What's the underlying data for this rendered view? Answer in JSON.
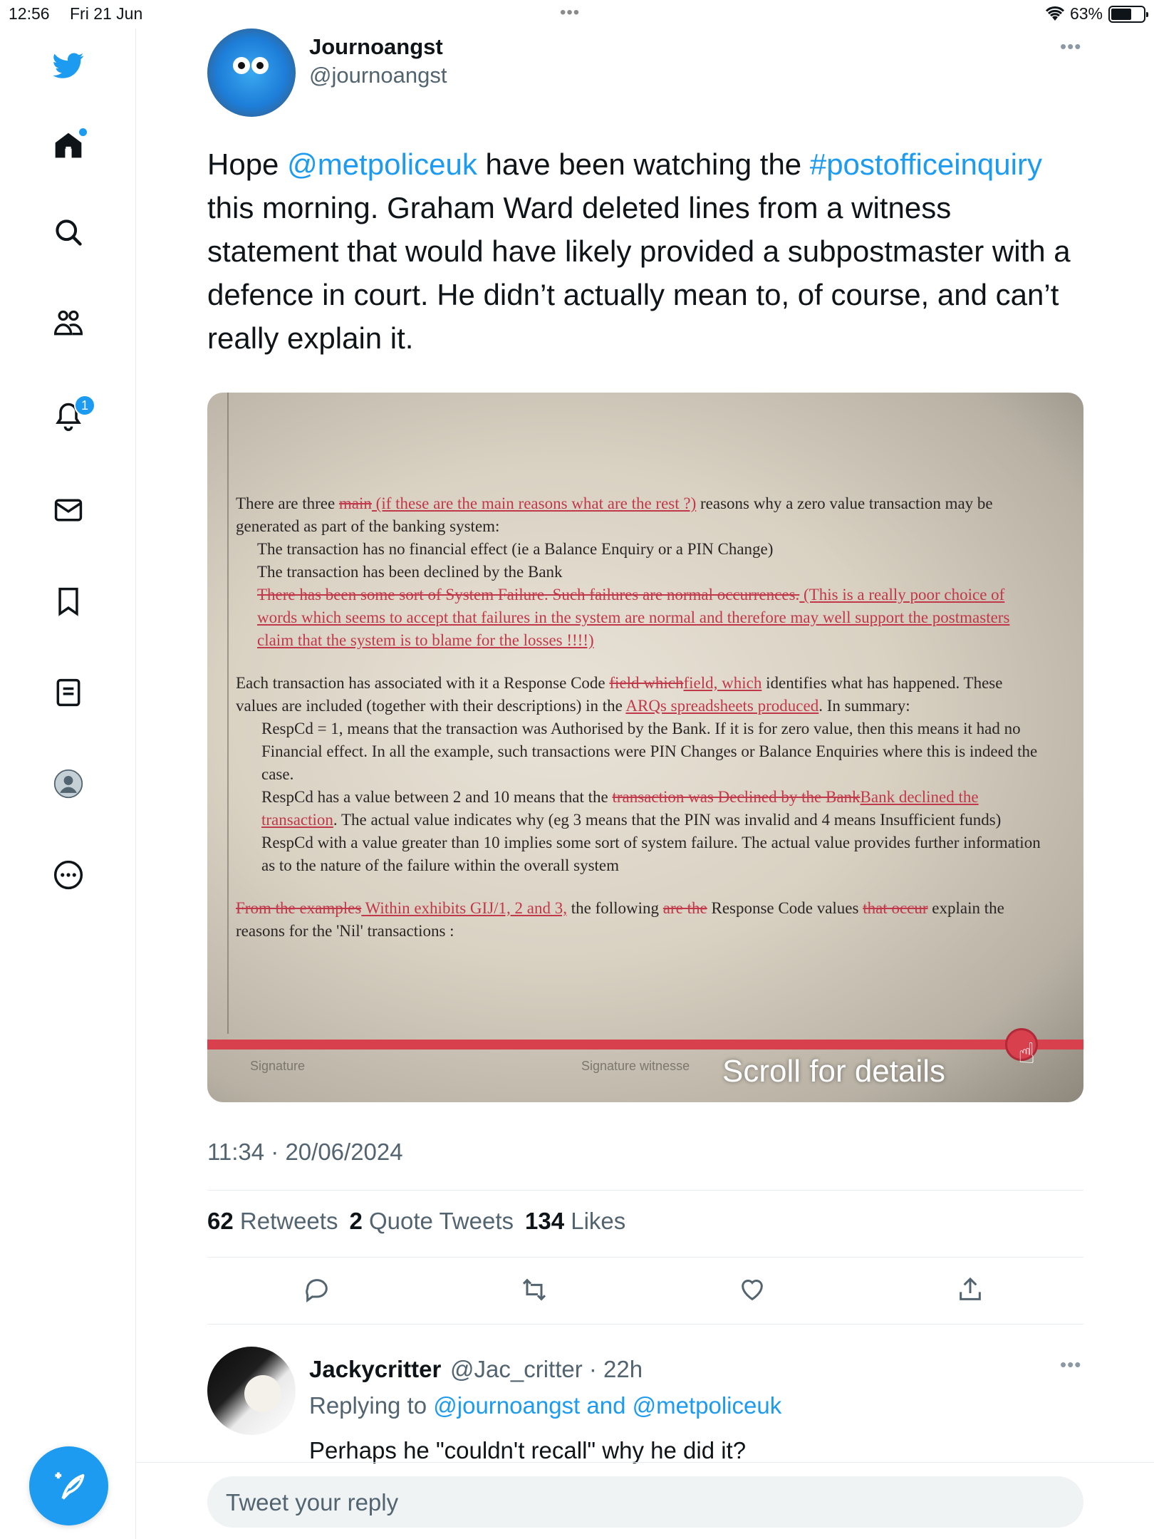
{
  "status_bar": {
    "time": "12:56",
    "date": "Fri 21 Jun",
    "battery": "63%",
    "battery_level": 0.63
  },
  "sidebar": {
    "items": [
      {
        "icon": "twitter-bird-icon"
      },
      {
        "icon": "home-icon",
        "has_dot": true
      },
      {
        "icon": "search-icon"
      },
      {
        "icon": "communities-icon"
      },
      {
        "icon": "notifications-icon",
        "badge": "1"
      },
      {
        "icon": "messages-icon"
      },
      {
        "icon": "bookmark-icon"
      },
      {
        "icon": "lists-icon"
      },
      {
        "icon": "profile-icon"
      },
      {
        "icon": "more-icon"
      }
    ],
    "compose_icon": "compose-tweet-icon"
  },
  "tweet": {
    "author_name": "Journoangst",
    "author_handle": "@journoangst",
    "text_parts": {
      "p1": "Hope ",
      "mention": "@metpoliceuk",
      "p2": " have been watching the ",
      "hashtag": "#postofficeinquiry",
      "p3": " this morning. Graham Ward deleted lines from a witness statement that would have likely provided a subpostmaster with a defence in court. He didn’t actually mean to, of course, and can’t really explain it."
    },
    "media": {
      "scroll_label": "Scroll for details",
      "signature_label": "Signature",
      "signature_witness_label": "Signature witnesse",
      "doc": {
        "para1_a": "There are three ",
        "para1_strike_main": "main",
        "para1_ul": " (if these are the main reasons what are the rest ?)",
        "para1_b": " reasons why a zero value transaction may be generated as part of the banking system:",
        "bullet1": "The transaction has no financial effect (ie a Balance Enquiry or a PIN Change)",
        "bullet2": "The transaction has been declined by the Bank",
        "bullet3_strike": "There has been some sort of System Failure.  Such failures are normal occurrences.",
        "bullet3_ul": " (This is a really poor choice of words which seems to accept that failures in the system are normal and therefore may well support the postmasters claim that the system is to blame for the losses !!!!)",
        "para2_a": "Each transaction has associated with it a Response Code ",
        "para2_strike": "field which",
        "para2_ul": "field, which",
        "para2_b": " identifies what has happened.  These values are included (together with their descriptions) in the ",
        "para2_ul2": "ARQs spreadsheets produced",
        "para2_c": ".  In summary:",
        "resp1": "RespCd = 1, means that the transaction was Authorised by the Bank.  If it is for zero value, then this means it had no Financial effect.  In all the example, such transactions were PIN Changes or Balance Enquiries where this is indeed the case.",
        "resp2_a": "RespCd has a value between 2 and 10 means that the ",
        "resp2_strike": "transaction was Declined by the Bank",
        "resp2_ul": "Bank declined the transaction",
        "resp2_b": ".  The actual value indicates why (eg 3 means that the PIN was invalid and 4 means Insufficient funds)",
        "resp3": "RespCd with a value greater than 10 implies some sort of system failure. The actual value provides further information as to the nature of the failure within the overall system",
        "para3_strike": "From the examples",
        "para3_ul": " Within exhibits GIJ/1, 2 and 3,",
        "para3_a": " the following ",
        "para3_strike2": "are the",
        "para3_b": " Response Code values ",
        "para3_strike3": "that occur",
        "para3_c": " explain the reasons for the 'Nil' transactions :"
      }
    },
    "timestamp": "11:34 · 20/06/2024",
    "stats": {
      "retweets_count": "62",
      "retweets_label": "Retweets",
      "quotes_count": "2",
      "quotes_label": "Quote Tweets",
      "likes_count": "134",
      "likes_label": "Likes"
    },
    "actions": [
      "reply-icon",
      "retweet-icon",
      "like-icon",
      "share-icon"
    ]
  },
  "reply": {
    "name": "Jackycritter",
    "handle_time": "@Jac_critter · 22h",
    "replying_prefix": "Replying to ",
    "replying_to": "@journoangst and @metpoliceuk",
    "text": "Perhaps he \"couldn't recall\" why he did it?"
  },
  "reply_box": {
    "placeholder": "Tweet your reply"
  },
  "colors": {
    "accent": "#1d9bf0",
    "text": "#0f1419",
    "secondary": "#536471",
    "progress": "#d8404e"
  }
}
